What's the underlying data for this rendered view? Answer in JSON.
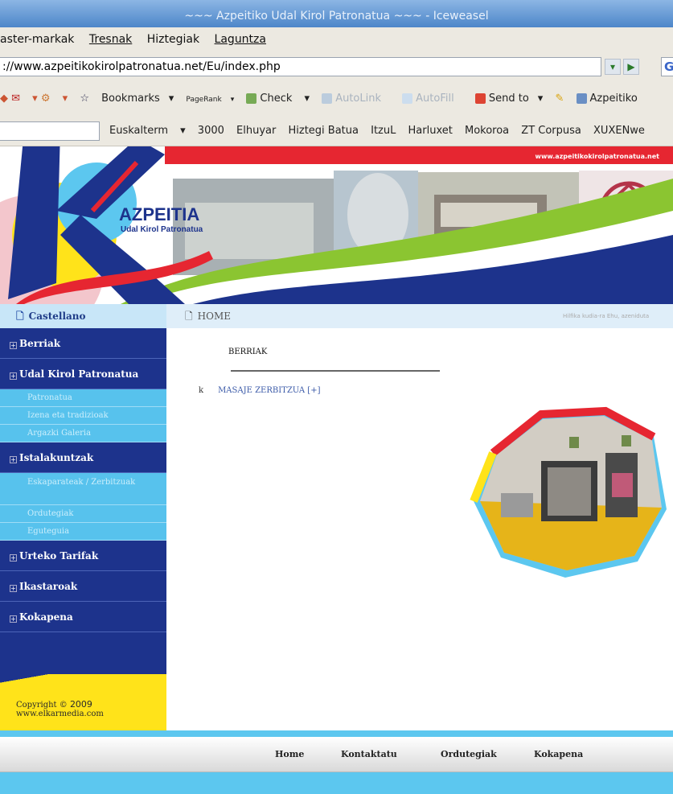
{
  "window": {
    "title": "~~~ Azpeitiko Udal Kirol Patronatua ~~~ - Iceweasel"
  },
  "menu": {
    "items": [
      "aster-markak",
      "Tresnak",
      "Hiztegiak",
      "Laguntza"
    ]
  },
  "address": {
    "url": "://www.azpeitikokirolpatronatua.net/Eu/index.php",
    "g_label": "G"
  },
  "toolbar": {
    "bookmarks": "Bookmarks",
    "pagerank": "PageRank",
    "check": "Check",
    "autolink": "AutoLink",
    "autofill": "AutoFill",
    "sendto": "Send to",
    "azpeitiko": "Azpeitiko"
  },
  "linkbar": {
    "items": [
      "Euskalterm",
      "3000",
      "Elhuyar",
      "Hiztegi Batua",
      "ItzuL",
      "Harluxet",
      "Mokoroa",
      "ZT Corpusa",
      "XUXENwe"
    ]
  },
  "banner": {
    "brand": "AZPEITIA",
    "brand_sub": "Udal Kirol Patronatua",
    "site_url": "www.azpeitikokirolpatronatua.net",
    "colors": {
      "blue": "#1d338c",
      "red": "#e62631",
      "green": "#8bc531",
      "yellow": "#ffe31a"
    }
  },
  "nav": {
    "language": "Castellano",
    "crumb": "HOME",
    "motto": "Hilfika kudia-ra Ehu, azeniduta"
  },
  "sidebar": {
    "items": [
      {
        "label": "Berriak"
      },
      {
        "label": "Udal Kirol Patronatua"
      },
      {
        "label": "Istalakuntzak"
      },
      {
        "label": "Urteko Tarifak"
      },
      {
        "label": "Ikastaroak"
      },
      {
        "label": "Kokapena"
      }
    ],
    "sub_patronatua": [
      "Patronatua",
      "Izena eta tradizioak",
      "Argazki Galeria"
    ],
    "sub_istalakuntzak": [
      "Eskaparateak / Zerbitzuak",
      "Ordutegiak",
      "Eguteguia"
    ]
  },
  "copyright": {
    "line1": "Copyright ©",
    "year": "2009",
    "line2": "www.elkarmedia.com"
  },
  "content": {
    "heading": "BERRIAK",
    "news_item": "MASAJE ZERBITZUA [+]",
    "news_icon": "k"
  },
  "footer": {
    "links": [
      "Home",
      "Kontaktatu",
      "Ordutegiak",
      "Kokapena"
    ]
  }
}
